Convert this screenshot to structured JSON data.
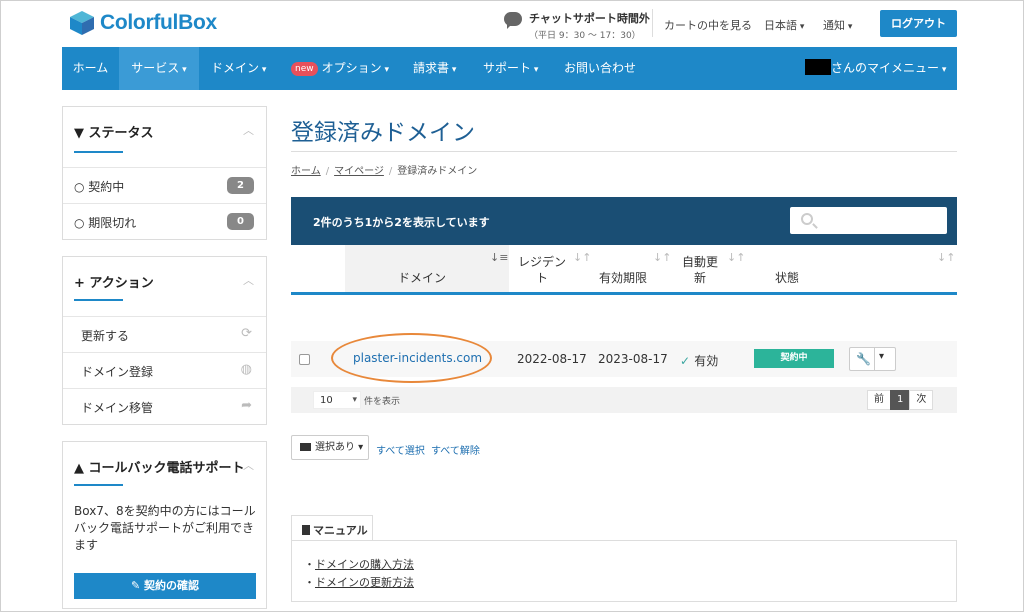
{
  "header": {
    "logo_text": "ColorfulBox",
    "chat_main": "チャットサポート時間外",
    "chat_sub": "（平日 9：30 〜 17：30）",
    "cart": "カートの中を見る",
    "language": "日本語",
    "notifications": "通知",
    "logout": "ログアウト"
  },
  "nav": {
    "home": "ホーム",
    "services": "サービス",
    "domains": "ドメイン",
    "new_badge": "new",
    "options": "オプション",
    "invoices": "請求書",
    "support": "サポート",
    "contact": "お問い合わせ",
    "my_menu": "さんのマイメニュー"
  },
  "sidebar": {
    "status": {
      "title": "ステータス",
      "items": [
        {
          "label": "契約中",
          "count": "2"
        },
        {
          "label": "期限切れ",
          "count": "0"
        }
      ]
    },
    "actions": {
      "title": "アクション",
      "items": [
        {
          "label": "更新する"
        },
        {
          "label": "ドメイン登録"
        },
        {
          "label": "ドメイン移管"
        }
      ]
    },
    "callback": {
      "title": "コールバック電話サポート",
      "text": "Box7、8を契約中の方にはコールバック電話サポートがご利用できます",
      "button": "契約の確認"
    }
  },
  "main": {
    "title": "登録済みドメイン",
    "breadcrumb": [
      "ホーム",
      "マイページ",
      "登録済みドメイン"
    ],
    "table_info": "2件のうち1から2を表示しています",
    "columns": {
      "domain": "ドメイン",
      "registrant_1": "レジデン",
      "registrant_2": "ト",
      "expiry": "有効期限",
      "auto_renew_1": "自動更",
      "auto_renew_2": "新",
      "status": "状態"
    },
    "rows": [
      {
        "domain": "plaster-incidents.com",
        "registered": "2022-08-17",
        "expiry": "2023-08-17",
        "auto_renew": "有効",
        "status": "契約中"
      }
    ],
    "per_page": "10",
    "per_page_label": "件を表示",
    "pager": {
      "prev": "前",
      "current": "1",
      "next": "次"
    },
    "bulk": {
      "with_selected": "選択あり",
      "select_all": "すべて選択",
      "deselect_all": "すべて解除"
    },
    "manual": {
      "tab": "マニュアル",
      "links": [
        "ドメインの購入方法",
        "ドメインの更新方法"
      ]
    }
  }
}
